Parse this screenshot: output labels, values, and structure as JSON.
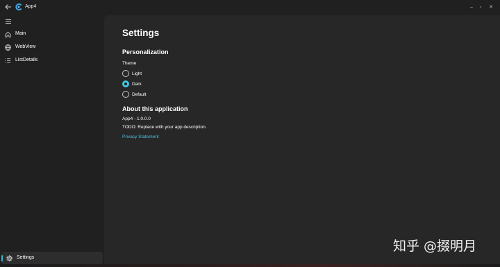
{
  "window": {
    "title": "App4",
    "back_icon": "arrow-left-icon",
    "app_icon": "app-logo-icon",
    "controls": {
      "minimize": "–",
      "maximize": "▫",
      "close": "✕"
    }
  },
  "nav": {
    "items": [
      {
        "label": "Main",
        "icon": "home-icon"
      },
      {
        "label": "WebView",
        "icon": "globe-icon"
      },
      {
        "label": "ListDetails",
        "icon": "list-icon"
      }
    ],
    "settings": {
      "label": "Settings",
      "icon": "gear-icon"
    }
  },
  "settings": {
    "title": "Settings",
    "personalization": {
      "heading": "Personalization",
      "theme_label": "Theme",
      "options": [
        "Light",
        "Dark",
        "Default"
      ],
      "selected": "Dark"
    },
    "about": {
      "heading": "About this application",
      "version": "App4 - 1.0.0.0",
      "description": "TODO: Replace with your app description.",
      "privacy_link": "Privacy Statement"
    }
  },
  "watermark": "知乎 @掇明月",
  "colors": {
    "accent": "#3fc7e0",
    "link": "#4cc2de",
    "background": "#202020",
    "content": "#272727"
  }
}
